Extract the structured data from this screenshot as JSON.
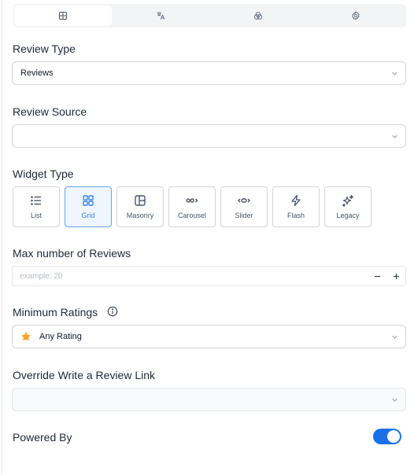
{
  "tabs": [
    {
      "icon": "layout-icon",
      "active": true
    },
    {
      "icon": "translate-icon",
      "active": false
    },
    {
      "icon": "palette-icon",
      "active": false
    },
    {
      "icon": "gear-icon",
      "active": false
    }
  ],
  "review_type": {
    "label": "Review Type",
    "value": "Reviews"
  },
  "review_source": {
    "label": "Review Source",
    "value": ""
  },
  "widget_type": {
    "label": "Widget Type",
    "options": [
      {
        "label": "List",
        "icon": "list-icon"
      },
      {
        "label": "Grid",
        "icon": "grid-icon",
        "selected": true
      },
      {
        "label": "Masonry",
        "icon": "masonry-icon"
      },
      {
        "label": "Carousel",
        "icon": "carousel-icon"
      },
      {
        "label": "Slider",
        "icon": "slider-icon"
      },
      {
        "label": "Flash",
        "icon": "flash-icon"
      },
      {
        "label": "Legacy",
        "icon": "sparkle-icon"
      }
    ]
  },
  "max_reviews": {
    "label": "Max number of Reviews",
    "placeholder": "example: 20"
  },
  "min_ratings": {
    "label": "Minimum Ratings",
    "value": "Any Rating"
  },
  "override_link": {
    "label": "Override Write a Review Link",
    "value": ""
  },
  "powered_by": {
    "label": "Powered By",
    "enabled": true
  },
  "colors": {
    "accent": "#1d6fe8",
    "star": "#f5a623"
  }
}
